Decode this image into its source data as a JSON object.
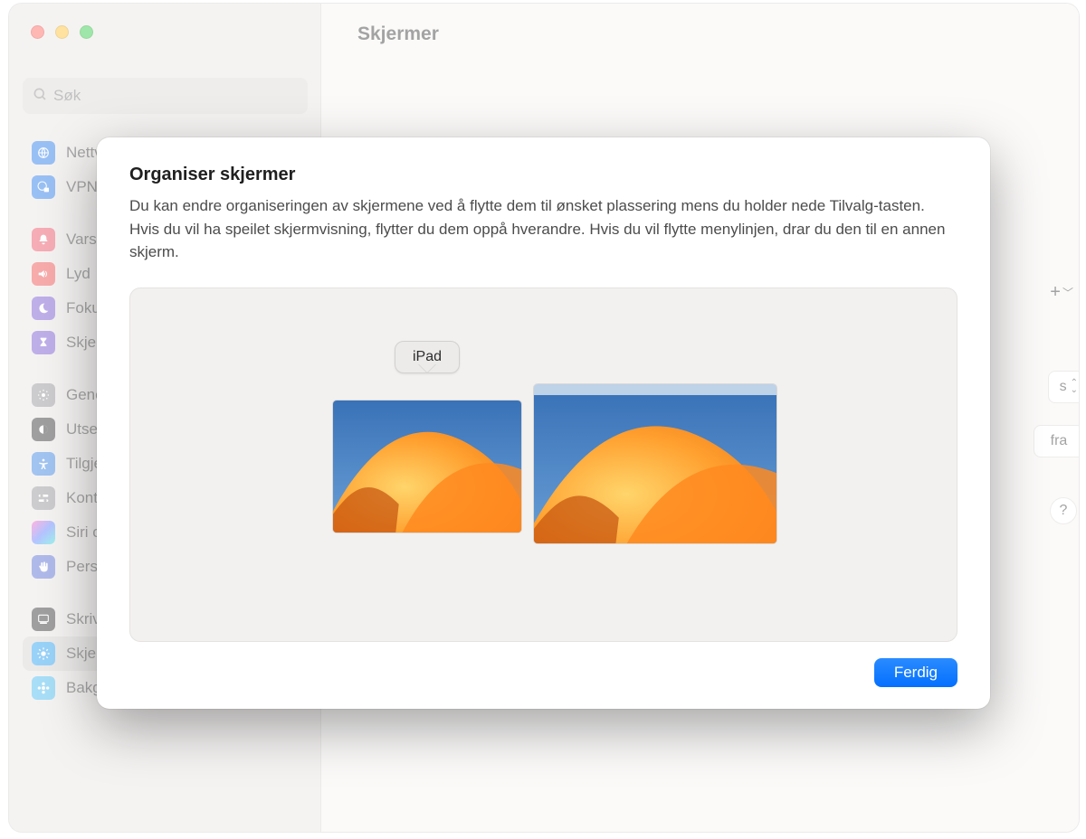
{
  "window": {
    "title": "Skjermer",
    "search_placeholder": "Søk",
    "right_stubs": {
      "s": "s",
      "fra": "fra",
      "help": "?"
    }
  },
  "sidebar": {
    "groups": [
      {
        "items": [
          {
            "label": "Nettverk"
          },
          {
            "label": "VPN"
          }
        ]
      },
      {
        "items": [
          {
            "label": "Varslinger"
          },
          {
            "label": "Lyd"
          },
          {
            "label": "Fokus"
          },
          {
            "label": "Skjermtid"
          }
        ]
      },
      {
        "items": [
          {
            "label": "Generelt"
          },
          {
            "label": "Utseende"
          },
          {
            "label": "Tilgjengelighet"
          },
          {
            "label": "Kontrollsenter"
          },
          {
            "label": "Siri og Spotlight"
          },
          {
            "label": "Personvern og sikkerhet"
          }
        ]
      },
      {
        "items": [
          {
            "label": "Skrivebord og Dock"
          },
          {
            "label": "Skjermer",
            "selected": true
          },
          {
            "label": "Bakgrunn"
          }
        ]
      }
    ]
  },
  "sheet": {
    "title": "Organiser skjermer",
    "description": "Du kan endre organiseringen av skjermene ved å flytte dem til ønsket plassering mens du holder nede Tilvalg-tasten. Hvis du vil ha speilet skjermvisning, flytter du dem oppå hverandre. Hvis du vil flytte menylinjen, drar du den til en annen skjerm.",
    "popover_label": "iPad",
    "done_label": "Ferdig"
  }
}
